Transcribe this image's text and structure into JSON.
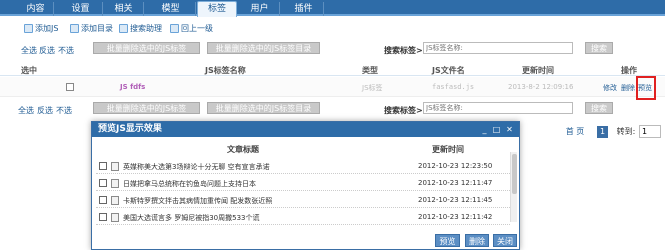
{
  "nav": {
    "tabs": [
      "内容",
      "设置",
      "相关",
      "模型",
      "标签",
      "用户",
      "插件"
    ],
    "active_index": 4
  },
  "toolbar": {
    "add_js": "添加JS",
    "add_dir": "添加目录",
    "search_help": "搜索助理",
    "back": "回上一级"
  },
  "actionbar": {
    "select_all": "全选",
    "invert": "反选",
    "none": "不选",
    "batch_delete_js": "批量删除选中的JS标签",
    "batch_delete_dir": "批量删除选中的JS标签目录",
    "search_label": "搜索标签>",
    "search_placeholder": "JS标签名称:",
    "search_btn": "搜索"
  },
  "actionbar2": {
    "select_all": "全选",
    "invert": "反选",
    "none": "不选",
    "batch_delete_js": "批量删除选中的JS标签",
    "batch_delete_dir": "批量删除选中的JS标签目录",
    "search_label": "搜索标签>",
    "search_placeholder": "JS标签名称:",
    "search_btn": "搜索"
  },
  "table": {
    "headers": {
      "select": "选中",
      "name": "JS标签名称",
      "type": "类型",
      "file": "JS文件名",
      "time": "更新时间",
      "action": "操作"
    },
    "row": {
      "name": "JS fdfs",
      "type": "JS标签",
      "file": "fasfasd.js",
      "time": "2013-8-2 12:09:16",
      "edit": "修改",
      "delete": "删除",
      "preview": "预览"
    }
  },
  "pager": {
    "home": "首 页",
    "current": "1",
    "goto": "转到:",
    "page_input": "1"
  },
  "modal": {
    "title": "预览JS显示效果",
    "col_title": "文章标题",
    "col_time": "更新时间",
    "rows": [
      {
        "title": "英媒称美大选第3场辩论十分无聊 空有宣言承诺",
        "time": "2012-10-23 12:23:50"
      },
      {
        "title": "日媒把拿马总统称在钓鱼岛问题上支持日本",
        "time": "2012-10-23 12:11:47"
      },
      {
        "title": "卡斯特罗撰文拌击其病情加重传闻 配发数张近照",
        "time": "2012-10-23 12:11:45"
      },
      {
        "title": "美国大选谎言多 罗姆尼被指30周撒533个谎",
        "time": "2012-10-23 12:11:42"
      }
    ],
    "buttons": {
      "preview": "预览",
      "delete": "删除",
      "close": "关闭"
    }
  }
}
